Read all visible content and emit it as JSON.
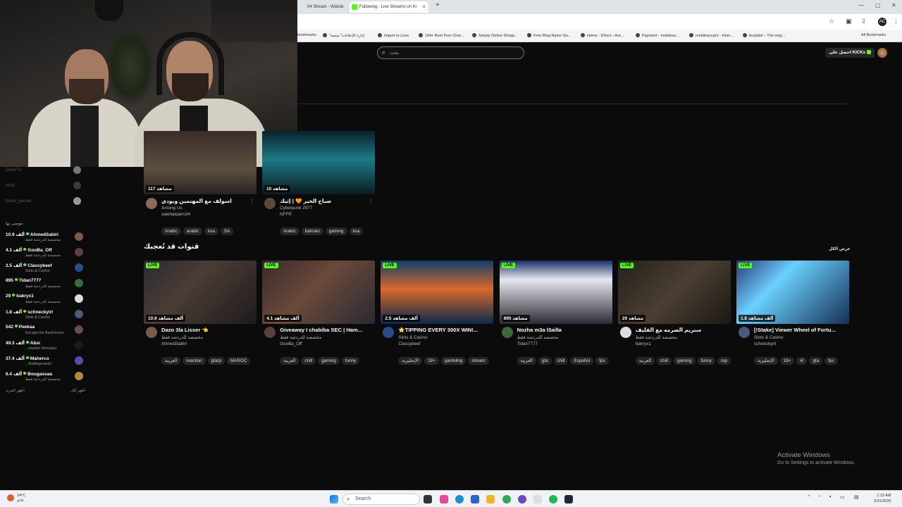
{
  "browser": {
    "tabs": [
      {
        "label": "04 Stream - Watch",
        "active": false
      },
      {
        "label": "Following - Live Streams on Ki",
        "active": true
      }
    ],
    "new_tab": "+",
    "bookmarks": [
      "bookmarks",
      "\"إدارة الإعلانات\" منصة",
      "Import to Loox",
      "194+ Best Free Char...",
      "Simply Online Shopp...",
      "Free Blog Name Ge...",
      "Home - DSers - Aut...",
      "Payment - mobileac...",
      "mobileaccpro - Hom...",
      "bustabit – The origi...",
      "All Bookmarks"
    ],
    "profile_initial": "AC"
  },
  "header": {
    "search_placeholder": "بحث",
    "get_kicks_label": "احصل على KICKs"
  },
  "sidebar": {
    "dim_channels": [
      "DylerTv",
      "Holz",
      "bode_gamer"
    ],
    "section_title": "موصى بها",
    "items": [
      {
        "name": "AhmedSabiri",
        "viewers": "10.9 ألف",
        "category": "مخصصة للدردشة فقط",
        "color": "#7a5a4a"
      },
      {
        "name": "GooBa_Off",
        "viewers": "4.1 ألف",
        "category": "مخصصة للدردشة فقط",
        "color": "#5a3f3f"
      },
      {
        "name": "Classybeef",
        "viewers": "2.5 ألف",
        "category": "Slots & Casino",
        "color": "#2a4a8a"
      },
      {
        "name": "7idan7777",
        "viewers": "895",
        "category": "مخصصة للدردشة فقط",
        "color": "#3a6a3a"
      },
      {
        "name": "bakryx1",
        "viewers": "29",
        "category": "مخصصة للدردشة فقط",
        "color": "#dddddd"
      },
      {
        "name": "schneckyirl",
        "viewers": "1.8 ألف",
        "category": "Slots & Casino",
        "color": "#4a5a7a"
      },
      {
        "name": "Peekaa",
        "viewers": "542",
        "category": "Escape the Backrooms",
        "color": "#6a4a5a"
      },
      {
        "name": "Absi",
        "viewers": "49.3 ألف",
        "category": "...market Simulator",
        "color": "#1a1a1a"
      },
      {
        "name": "Maherco",
        "viewers": "37.4 ألف",
        "category": "...Battlegrounds",
        "color": "#5a4aaa"
      },
      {
        "name": "Bougassaa",
        "viewers": "6.4 ألف",
        "category": "مخصصة للدردشة فقط",
        "color": "#b08a3a"
      }
    ],
    "show_more": "أظهر المزيد",
    "show_less": "أظهر أقل"
  },
  "top_cards": [
    {
      "viewers": "117 مشاهد",
      "title": "اسولف مع المهتمين وبودي",
      "category": "Among Us",
      "user": "salehalqarni34",
      "tags": [
        "Arabic",
        "arabic",
        "ksa",
        "SA"
      ],
      "avatar_color": "#8a6a5a"
    },
    {
      "viewers": "10 مشاهد",
      "title": "صباح الخير 🧡 | إثيك",
      "category": "Cyberpunk 2077",
      "user": "NFFR",
      "tags": [
        "Arabic",
        "bahrain",
        "gaming",
        "ksa"
      ],
      "avatar_color": "#5a4a3a"
    }
  ],
  "section": {
    "title": "قنوات قد تُعجبك",
    "show_all": "عرض الكل"
  },
  "cards": [
    {
      "live": "LIVE",
      "viewers": "10.9 ألف مشاهد",
      "title": "Dazo 3la Lisser 👈",
      "category": "مخصصة للدردشة فقط",
      "user": "AhmedSabiri",
      "tags": [
        "العربية",
        "reaction",
        "gtarp",
        "MAROC"
      ],
      "avatar_color": "#7a5a4a"
    },
    {
      "live": "LIVE",
      "viewers": "4.1 ألف مشاهد",
      "title": "Giveaway I chabiba SEC | Ham...",
      "category": "مخصصة للدردشة فقط",
      "user": "GooBa_Off",
      "tags": [
        "العربية",
        "chill",
        "gaming",
        "funny"
      ],
      "avatar_color": "#5a3f3f"
    },
    {
      "live": "LIVE",
      "viewers": "2.5 ألف مشاهد",
      "title": "⭐TIPPING EVERY 300X WIN!...",
      "category": "Slots & Casino",
      "user": "Classybeef",
      "tags": [
        "الإنجليزية",
        "18+",
        "gambling",
        "stream"
      ],
      "avatar_color": "#2a4a8a"
    },
    {
      "live": "LIVE",
      "viewers": "895 مشاهد",
      "title": "Nozha m3a l3ailla",
      "category": "مخصصة للدردشة فقط",
      "user": "7idan7777",
      "tags": [
        "العربية",
        "gta",
        "chill",
        "Español",
        "fps"
      ],
      "avatar_color": "#3a6a3a"
    },
    {
      "live": "LIVE",
      "viewers": "29 مشاهد",
      "title": "ستريم الصرمه مع القليف",
      "category": "مخصصة للدردشة فقط",
      "user": "bakryx1",
      "tags": [
        "العربية",
        "chill",
        "gaming",
        "funny",
        "rap"
      ],
      "avatar_color": "#dddddd"
    },
    {
      "live": "LIVE",
      "viewers": "1.8 ألف مشاهد",
      "title": "[!Stake] Viewer Wheel of Fortu...",
      "category": "Slots & Casino",
      "user": "schneckyirl",
      "tags": [
        "الإنجليزية",
        "18+",
        "irl",
        "gta",
        "fps"
      ],
      "avatar_color": "#4a5a7a"
    }
  ],
  "watermark": {
    "line1": "Activate Windows",
    "line2": "Go to Settings to activate Windows."
  },
  "taskbar": {
    "weather_temp": "24°C",
    "weather_desc": "غائم",
    "search_label": "Search",
    "time": "1:19 AM",
    "date": "3/31/2026"
  }
}
